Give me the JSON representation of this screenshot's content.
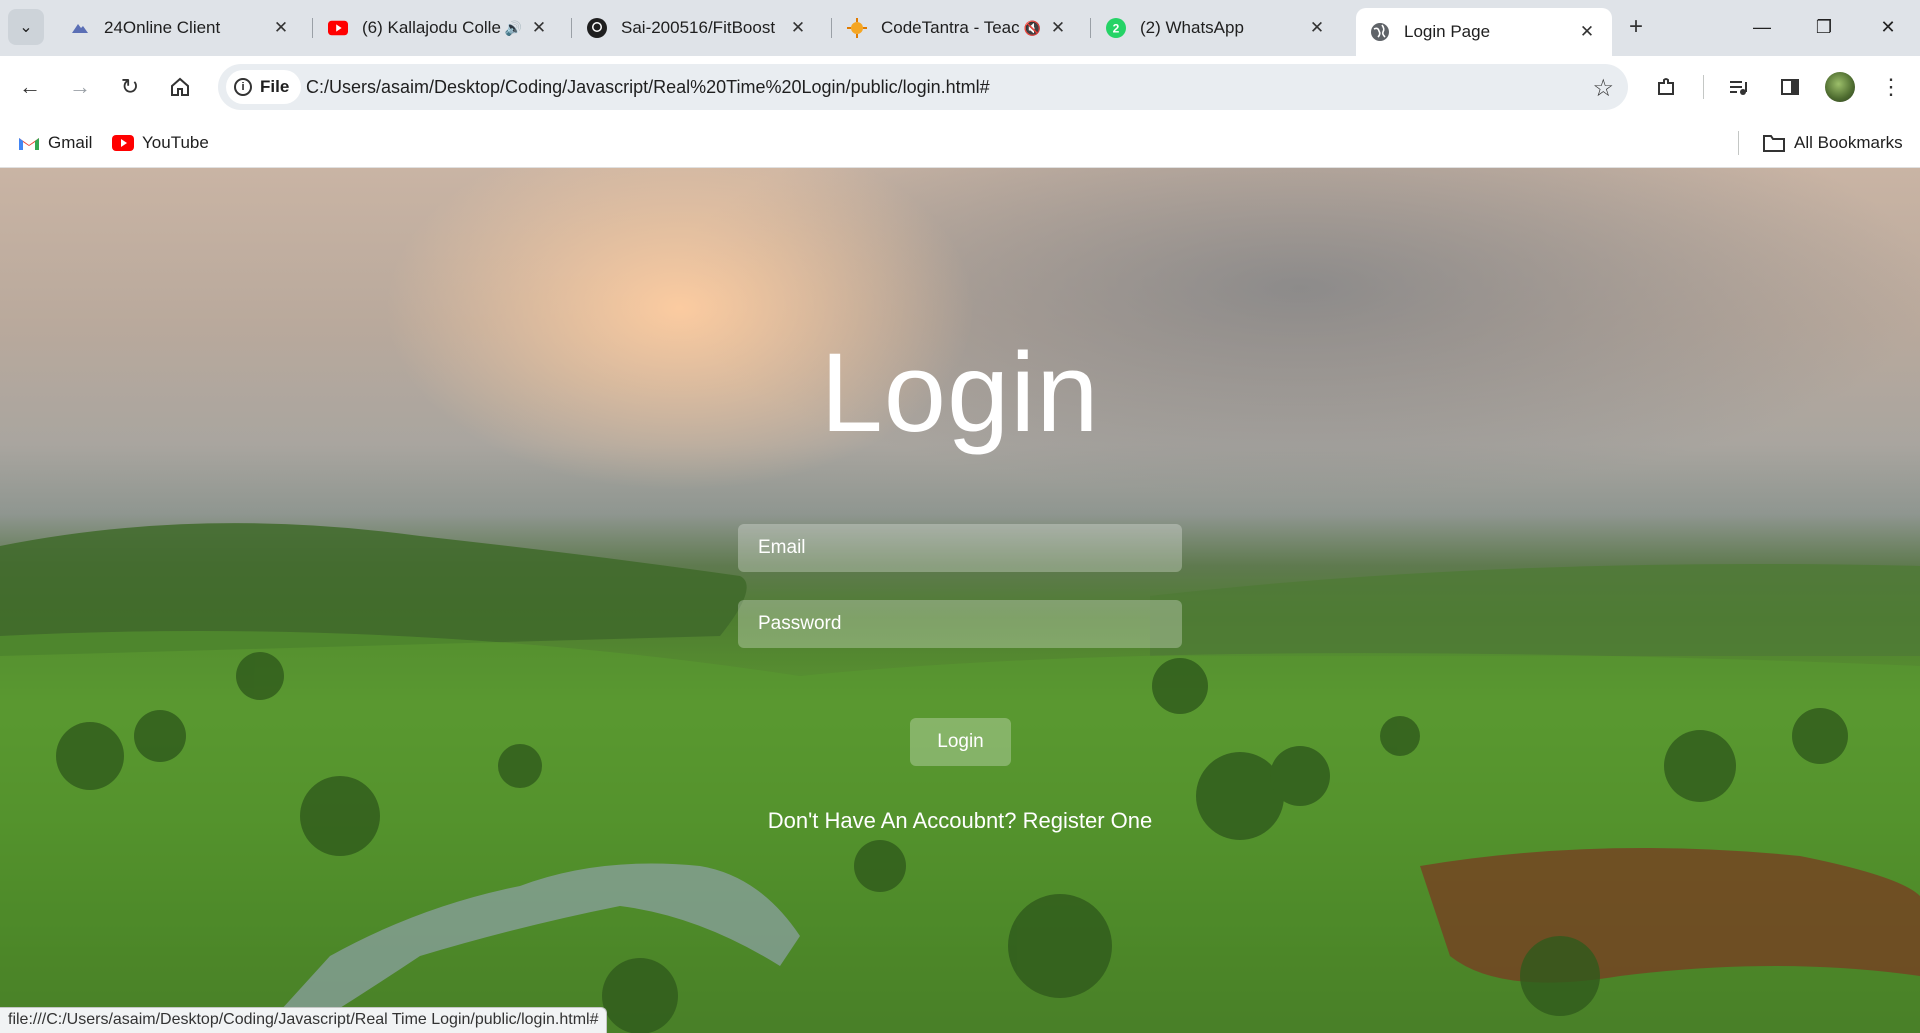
{
  "browser": {
    "tabs": [
      {
        "title": "24Online Client",
        "icon": "24online-icon",
        "active": false
      },
      {
        "title": "(6) Kallajodu Colle",
        "icon": "youtube-icon",
        "active": false,
        "audio": "speaker-icon"
      },
      {
        "title": "Sai-200516/FitBoost",
        "icon": "github-icon",
        "active": false
      },
      {
        "title": "CodeTantra - Teac",
        "icon": "codetantra-icon",
        "active": false,
        "audio": "muted-icon"
      },
      {
        "title": "(2) WhatsApp",
        "icon": "whatsapp-icon",
        "active": false
      },
      {
        "title": "Login Page",
        "icon": "globe-icon",
        "active": true
      }
    ],
    "chip_label": "File",
    "url": "C:/Users/asaim/Desktop/Coding/Javascript/Real%20Time%20Login/public/login.html#",
    "bookmarks": [
      {
        "label": "Gmail",
        "icon": "gmail-icon"
      },
      {
        "label": "YouTube",
        "icon": "youtube-icon"
      }
    ],
    "all_bookmarks_label": "All Bookmarks",
    "status_url": "file:///C:/Users/asaim/Desktop/Coding/Javascript/Real Time Login/public/login.html#"
  },
  "page": {
    "title": "Login",
    "email_placeholder": "Email",
    "password_placeholder": "Password",
    "login_button": "Login",
    "register_text": "Don't Have An Accoubnt? Register One"
  }
}
